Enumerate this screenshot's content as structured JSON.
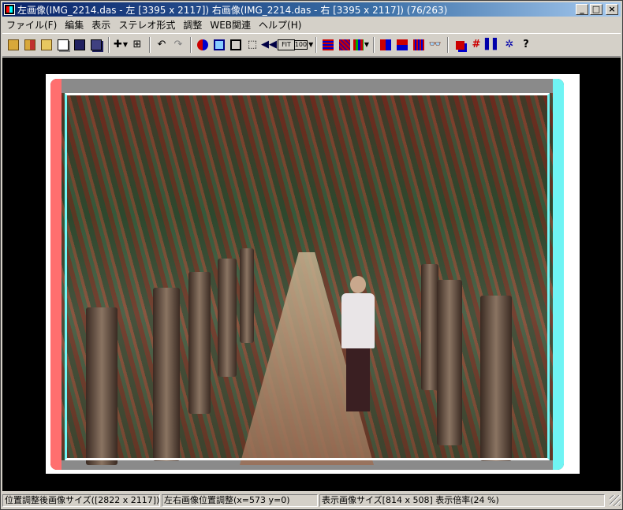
{
  "window": {
    "title": "左画像(IMG_2214.das - 左 [3395 x 2117]) 右画像(IMG_2214.das - 右 [3395 x 2117])  (76/263)",
    "minimize_label": "_",
    "maximize_label": "□",
    "close_label": "×"
  },
  "menu": {
    "items": [
      {
        "label": "ファイル(F)"
      },
      {
        "label": "編集"
      },
      {
        "label": "表示"
      },
      {
        "label": "ステレオ形式"
      },
      {
        "label": "調整"
      },
      {
        "label": "WEB関連"
      },
      {
        "label": "ヘルプ(H)"
      }
    ]
  },
  "toolbar": {
    "fit_label": "FIT",
    "zoom_label": "100",
    "help_label": "?"
  },
  "status": {
    "adjusted_size": "位置調整後画像サイズ([2822 x 2117])",
    "position_adjust": "左右画像位置調整(x=573 y=0)",
    "display_size": "表示画像サイズ[814 x 508]  表示倍率(24 %)"
  },
  "colors": {
    "titlebar_start": "#0a246a",
    "titlebar_end": "#a6caf0",
    "anaglyph_red": "#ff6f6f",
    "anaglyph_cyan": "#6ff4f4"
  }
}
